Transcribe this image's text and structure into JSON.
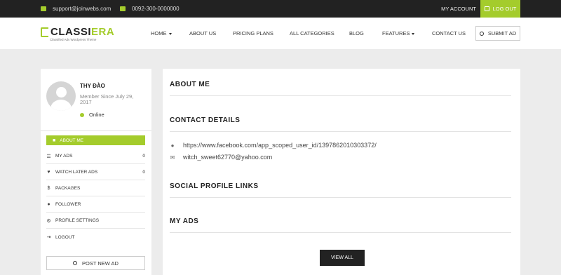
{
  "topbar": {
    "email": "support@joinwebs.com",
    "phone": "0092-300-0000000",
    "my_account": "MY ACCOUNT",
    "logout": "LOG OUT"
  },
  "header": {
    "logo_main": "CLASSI",
    "logo_accent": "ERA",
    "logo_tagline": "Classified Ads Wordpress Theme",
    "nav": [
      "HOME",
      "ABOUT US",
      "PRICING PLANS",
      "ALL CATEGORIES",
      "BLOG",
      "FEATURES",
      "CONTACT US"
    ],
    "submit_ad": "SUBMIT AD"
  },
  "profile": {
    "name": "THY ĐÀO",
    "member_since": "Member Since July 29, 2017",
    "status": "Online"
  },
  "menu": {
    "active": "ABOUT ME",
    "items": [
      {
        "label": "MY ADS",
        "count": "0",
        "icon": "list-icon"
      },
      {
        "label": "WATCH LATER ADS",
        "count": "0",
        "icon": "heart-icon"
      },
      {
        "label": "PACKAGES",
        "count": "",
        "icon": "dollar-icon"
      },
      {
        "label": "FOLLOWER",
        "count": "",
        "icon": "users-icon"
      },
      {
        "label": "PROFILE SETTINGS",
        "count": "",
        "icon": "gear-icon"
      },
      {
        "label": "LOGOUT",
        "count": "",
        "icon": "signout-icon"
      }
    ],
    "post_new_ad": "POST NEW AD"
  },
  "main": {
    "about_me": "ABOUT ME",
    "contact_details": "CONTACT DETAILS",
    "website": "https://www.facebook.com/app_scoped_user_id/1397862010303372/",
    "email": "witch_sweet62770@yahoo.com",
    "social_links": "SOCIAL PROFILE LINKS",
    "my_ads": "MY ADS",
    "view_all": "VIEW ALL"
  },
  "colors": {
    "accent": "#a4cc2c",
    "topbar": "#222222",
    "page_bg": "#ececec"
  }
}
